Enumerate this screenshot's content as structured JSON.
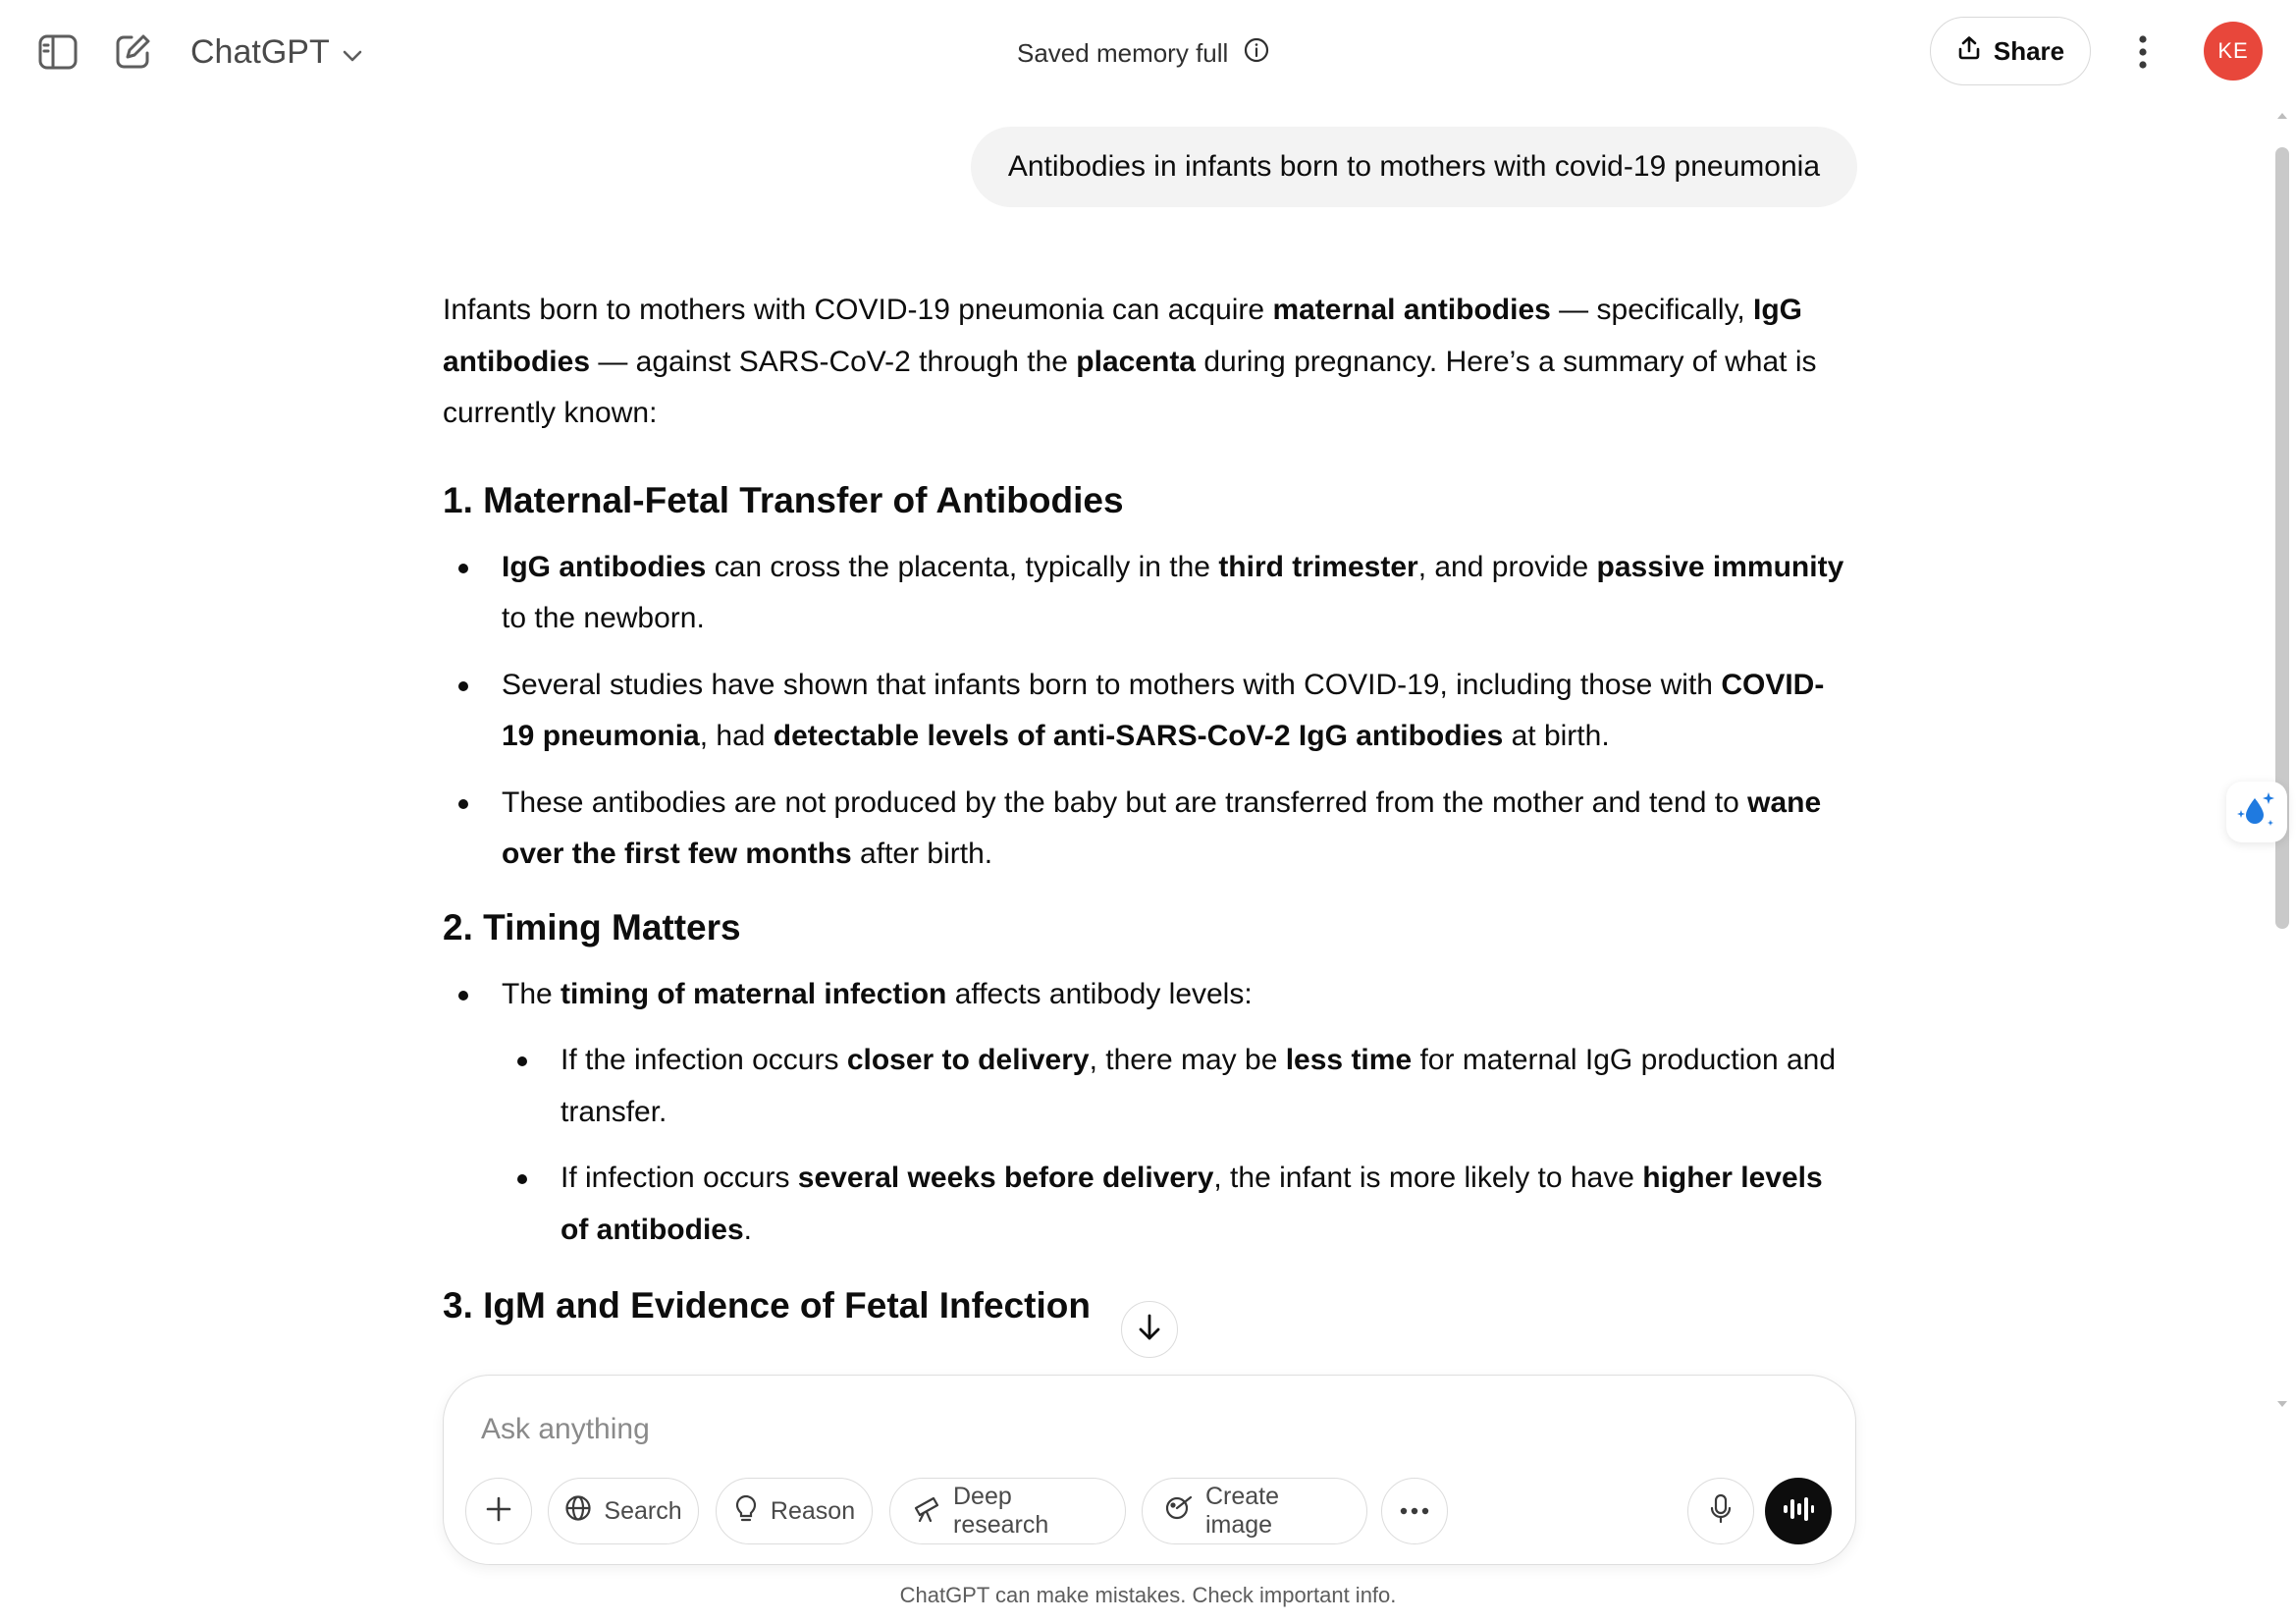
{
  "header": {
    "sidebar_toggle_icon": "sidebar-toggle-icon",
    "new_chat_icon": "new-chat-icon",
    "model_name": "ChatGPT",
    "memory_status": "Saved memory full",
    "share_label": "Share",
    "avatar_initials": "KE",
    "avatar_color": "#e8473b"
  },
  "conversation": {
    "user_message": "Antibodies in infants born to mothers with covid-19 pneumonia",
    "intro": [
      {
        "t": "Infants born to mothers with COVID-19 pneumonia can acquire "
      },
      {
        "t": "maternal antibodies",
        "b": true
      },
      {
        "t": " — specifically, "
      },
      {
        "t": "IgG antibodies",
        "b": true
      },
      {
        "t": " — against SARS-CoV-2 through the "
      },
      {
        "t": "placenta",
        "b": true
      },
      {
        "t": " during pregnancy. Here’s a summary of what is currently known:"
      }
    ],
    "section1": {
      "number": "1.",
      "title": "Maternal-Fetal Transfer of Antibodies",
      "bullets": [
        [
          {
            "t": "IgG antibodies",
            "b": true
          },
          {
            "t": " can cross the placenta, typically in the "
          },
          {
            "t": "third trimester",
            "b": true
          },
          {
            "t": ", and provide "
          },
          {
            "t": "passive immunity",
            "b": true
          },
          {
            "t": " to the newborn."
          }
        ],
        [
          {
            "t": "Several studies have shown that infants born to mothers with COVID-19, including those with "
          },
          {
            "t": "COVID-19 pneumonia",
            "b": true
          },
          {
            "t": ", had "
          },
          {
            "t": "detectable levels of anti-SARS-CoV-2 IgG antibodies",
            "b": true
          },
          {
            "t": " at birth."
          }
        ],
        [
          {
            "t": "These antibodies are not produced by the baby but are transferred from the mother and tend to "
          },
          {
            "t": "wane over the first few months",
            "b": true
          },
          {
            "t": " after birth."
          }
        ]
      ]
    },
    "section2": {
      "number": "2.",
      "title": "Timing Matters",
      "bullet": [
        {
          "t": "The "
        },
        {
          "t": "timing of maternal infection",
          "b": true
        },
        {
          "t": " affects antibody levels:"
        }
      ],
      "sub_bullets": [
        [
          {
            "t": "If the infection occurs "
          },
          {
            "t": "closer to delivery",
            "b": true
          },
          {
            "t": ", there may be "
          },
          {
            "t": "less time",
            "b": true
          },
          {
            "t": " for maternal IgG production and transfer."
          }
        ],
        [
          {
            "t": "If infection occurs "
          },
          {
            "t": "several weeks before delivery",
            "b": true
          },
          {
            "t": ", the infant is more likely to have "
          },
          {
            "t": "higher levels of antibodies",
            "b": true
          },
          {
            "t": "."
          }
        ]
      ]
    },
    "section3": {
      "number": "3.",
      "title": "IgM and Evidence of Fetal Infection"
    }
  },
  "composer": {
    "placeholder": "Ask anything",
    "buttons": {
      "add": "plus-icon",
      "search": "Search",
      "reason": "Reason",
      "deep_research": "Deep research",
      "create_image": "Create image",
      "more": "more-icon"
    },
    "mic_icon": "microphone-icon",
    "voice_icon": "voice-mode-icon"
  },
  "footer": {
    "disclaimer": "ChatGPT can make mistakes. Check important info."
  }
}
